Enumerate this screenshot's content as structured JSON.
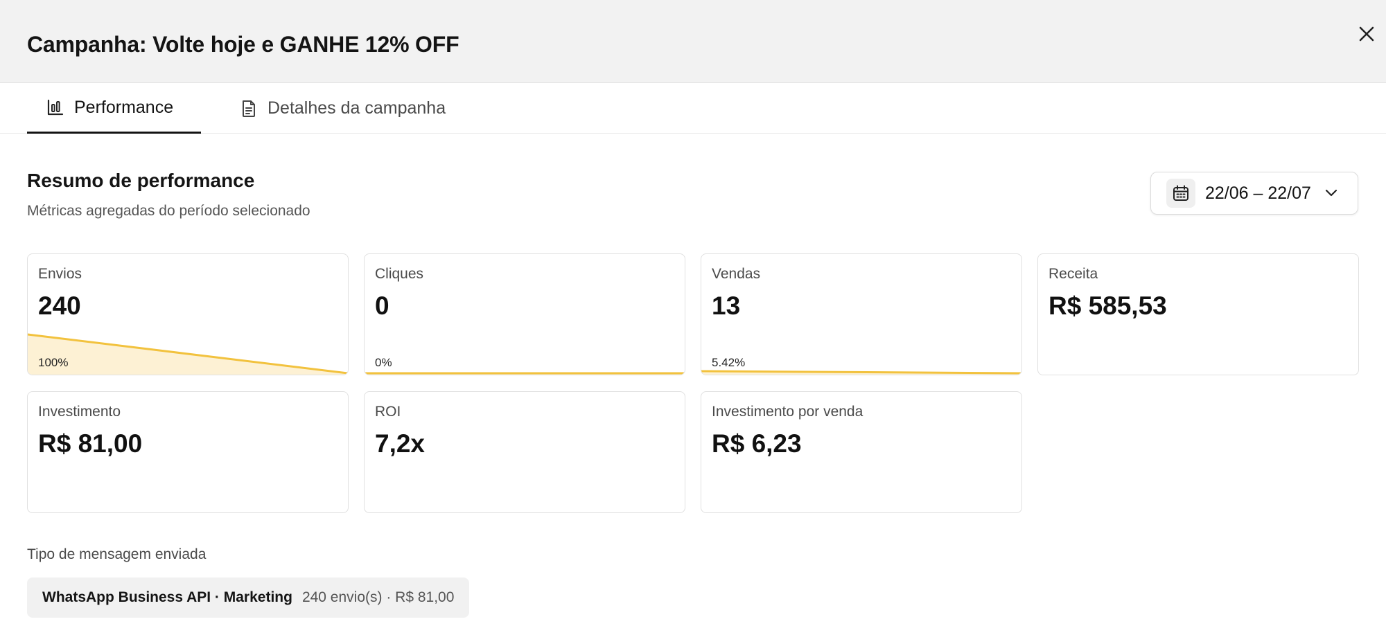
{
  "header": {
    "title": "Campanha: Volte hoje e GANHE 12% OFF"
  },
  "tabs": [
    {
      "label": "Performance",
      "icon": "bar-chart-icon",
      "active": true
    },
    {
      "label": "Detalhes da campanha",
      "icon": "document-icon",
      "active": false
    }
  ],
  "summary": {
    "title": "Resumo de performance",
    "subtitle": "Métricas agregadas do período selecionado"
  },
  "date_range": {
    "label": "22/06 – 22/07",
    "icon": "calendar-icon"
  },
  "metrics": [
    {
      "label": "Envios",
      "value": "240",
      "percent_label": "100%",
      "rate": 1.0
    },
    {
      "label": "Cliques",
      "value": "0",
      "percent_label": "0%",
      "rate": 0.0
    },
    {
      "label": "Vendas",
      "value": "13",
      "percent_label": "5.42%",
      "rate": 0.0542
    },
    {
      "label": "Receita",
      "value": "R$ 585,53"
    },
    {
      "label": "Investimento",
      "value": "R$ 81,00"
    },
    {
      "label": "ROI",
      "value": "7,2x"
    },
    {
      "label": "Investimento por venda",
      "value": "R$ 6,23"
    }
  ],
  "message_types": {
    "label": "Tipo de mensagem enviada",
    "items": [
      {
        "name": "WhatsApp Business API · Marketing",
        "meta": "240 envio(s) · R$ 81,00"
      }
    ]
  },
  "colors": {
    "accent": "#f2c23e",
    "accent_fill": "#fdf1d4"
  }
}
